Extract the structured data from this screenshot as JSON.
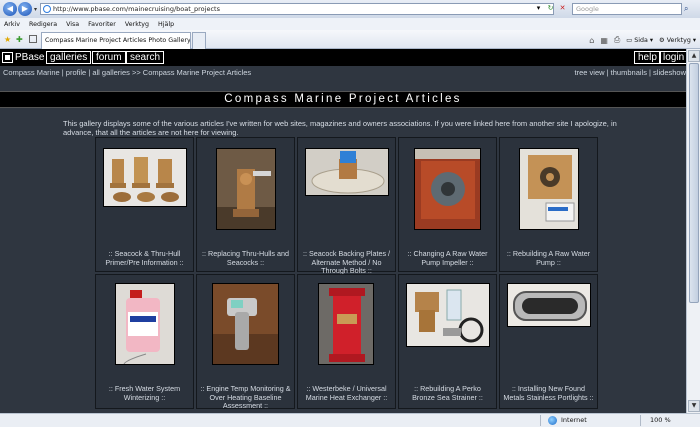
{
  "browser": {
    "url": "http://www.pbase.com/mainecruising/boat_projects",
    "search_placeholder": "Google",
    "tab_title": "Compass Marine Project Articles Photo Gallery by Com...",
    "menu": [
      "Arkiv",
      "Redigera",
      "Visa",
      "Favoriter",
      "Verktyg",
      "Hjälp"
    ],
    "toolbar": {
      "page_label": "Sida",
      "tools_label": "Verktyg"
    },
    "status": {
      "zone": "Internet",
      "zoom": "100 %"
    }
  },
  "site": {
    "nav": [
      "PBase",
      "galleries",
      "forum",
      "search"
    ],
    "nav_right": [
      "help",
      "login"
    ],
    "breadcrumb": "Compass Marine | profile | all galleries >> Compass Marine Project Articles",
    "views": "tree view | thumbnails | slideshow",
    "title": "Compass Marine Project Articles",
    "description": "This gallery displays some of the various articles I've written for web sites, magazines and owners associations. If you were linked here from another site I apologize, in advance, that all the articles are not here for viewing."
  },
  "gallery": [
    {
      "caption": ":: Seacock & Thru-Hull Primer/Pre Information ::",
      "icon": "bronze-seacock-parts-photo"
    },
    {
      "caption": ":: Replacing Thru-Hulls and Seacocks ::",
      "icon": "seacock-valve-photo"
    },
    {
      "caption": ":: Seacock Backing Plates / Alternate Method / No Through Bolts ::",
      "icon": "backing-plate-photo"
    },
    {
      "caption": ":: Changing A Raw Water Pump Impeller ::",
      "icon": "water-pump-photo"
    },
    {
      "caption": ":: Rebuilding A Raw Water Pump ::",
      "icon": "pump-rebuild-photo"
    },
    {
      "caption": ":: Fresh Water System Winterizing ::",
      "icon": "antifreeze-bottle-photo"
    },
    {
      "caption": ":: Engine Temp Monitoring & Over Heating Baseline Assessment ::",
      "icon": "infrared-thermometer-photo"
    },
    {
      "caption": ":: Westerbeke / Universal Marine Heat Exchanger ::",
      "icon": "heat-exchanger-photo"
    },
    {
      "caption": ":: Rebuilding A Perko Bronze Sea Strainer ::",
      "icon": "sea-strainer-photo"
    },
    {
      "caption": ":: Installing New Found Metals Stainless Portlights ::",
      "icon": "portlight-photo"
    }
  ]
}
